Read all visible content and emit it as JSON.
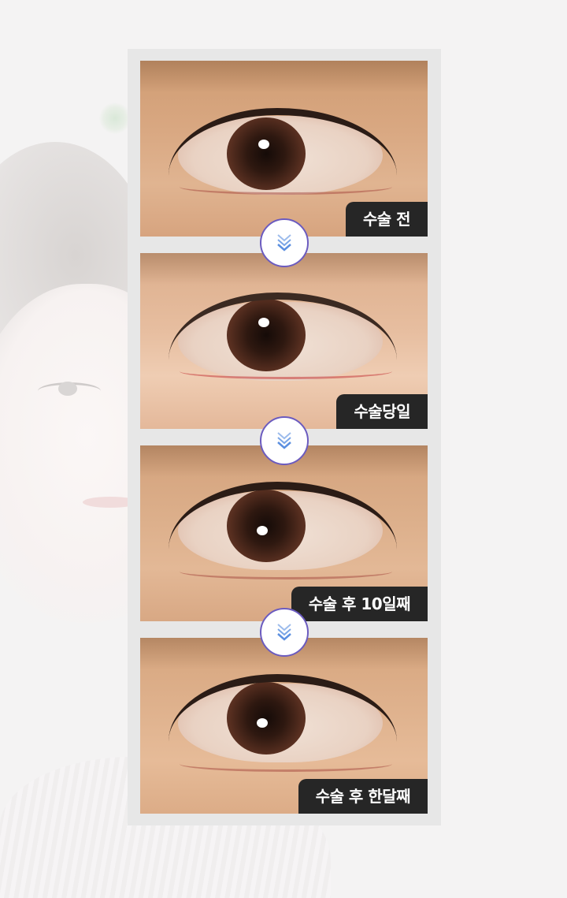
{
  "colors": {
    "page_background": "#f4f3f3",
    "panel_background": "#e7e7e7",
    "label_background": "#262626",
    "label_text": "#ffffff",
    "arrow_ring": "#6b5bbf",
    "arrow_chevron": "#5b8fe0"
  },
  "stages": [
    {
      "label": "수술 전"
    },
    {
      "label": "수술당일"
    },
    {
      "label": "수술 후 10일째"
    },
    {
      "label": "수술 후 한달째"
    }
  ],
  "arrows": [
    {
      "icon": "double-chevron-down-icon"
    },
    {
      "icon": "double-chevron-down-icon"
    },
    {
      "icon": "double-chevron-down-icon"
    }
  ]
}
